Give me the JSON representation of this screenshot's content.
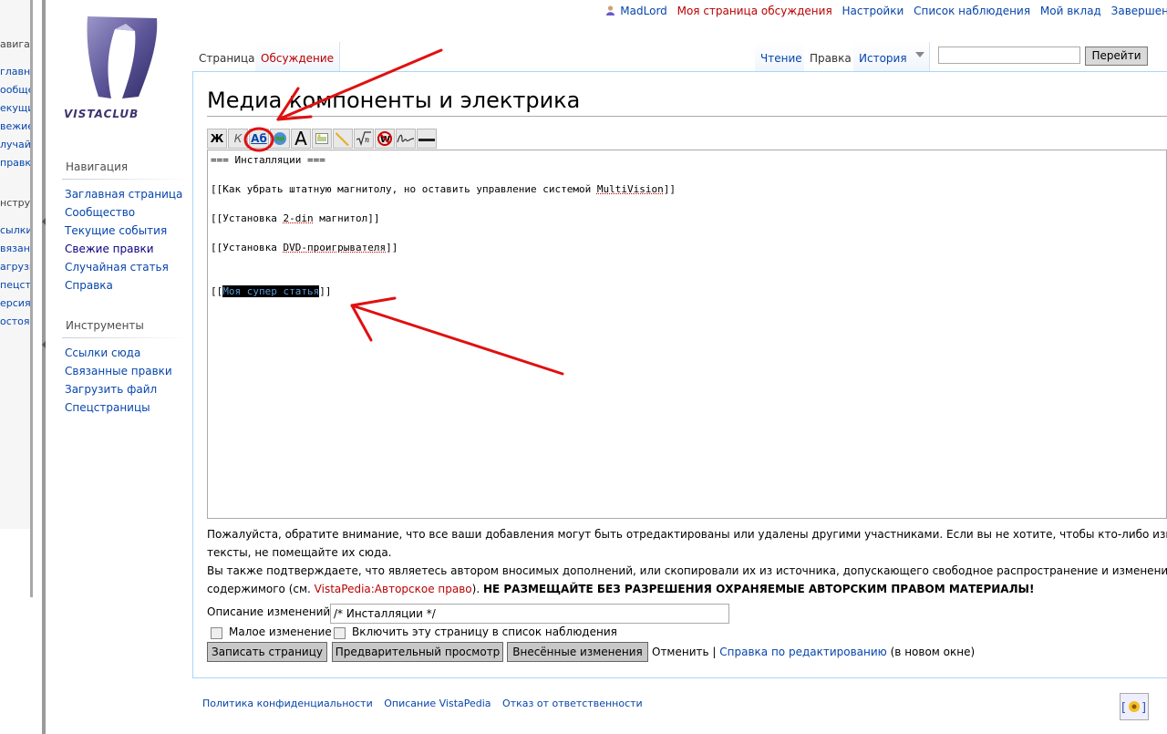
{
  "left_window": {
    "items": [
      "авигац",
      "главн",
      "ообще",
      "екущие",
      "вежие",
      "лучайн",
      "правка",
      "нструм",
      "сылки",
      "вязанн",
      "агрузит",
      "пецстр",
      "ерсия",
      "остоян"
    ]
  },
  "logo": {
    "text": "VISTACLUB"
  },
  "sidebar": {
    "nav_heading": "Навигация",
    "nav_items": [
      "Заглавная страница",
      "Сообщество",
      "Текущие события",
      "Свежие правки",
      "Случайная статья",
      "Справка"
    ],
    "tools_heading": "Инструменты",
    "tools_items": [
      "Ссылки сюда",
      "Связанные правки",
      "Загрузить файл",
      "Спецстраницы"
    ]
  },
  "personal": {
    "user": "MadLord",
    "talk": "Моя страница обсуждения",
    "prefs": "Настройки",
    "watchlist": "Список наблюдения",
    "contribs": "Мой вклад",
    "logout": "Завершен"
  },
  "tabs": {
    "page": "Страница",
    "talk": "Обсуждение",
    "read": "Чтение",
    "edit": "Правка",
    "history": "История"
  },
  "search": {
    "button": "Перейти",
    "value": ""
  },
  "page_title": "Медиа компоненты и электрика",
  "toolbar": {
    "bold": "Ж",
    "italic": "К",
    "link": "Аб",
    "headline": "A"
  },
  "editor": {
    "line1": "=== Инсталляции ===",
    "line2a": "[[Как убрать штатную магнитолу, но оставить управление системой ",
    "line2b": "MultiVision",
    "line2c": "]]",
    "line3a": "[[Установка ",
    "line3b": "2-din",
    "line3c": " магнитол]]",
    "line4a": "[[Установка ",
    "line4b": "DVD-проигрывателя",
    "line4c": "]]",
    "line5a": "[[",
    "line5b": "Моя супер статья",
    "line5c": "]]"
  },
  "notice": {
    "line1": "Пожалуйста, обратите внимание, что все ваши добавления могут быть отредактированы или удалены другими участниками. Если вы не хотите, чтобы кто-либо изменял ва",
    "line2": "тексты, не помещайте их сюда.",
    "line3": "Вы также подтверждаете, что являетесь автором вносимых дополнений, или скопировали их из источника, допускающего свободное распространение и изменение своег",
    "line4a": "содержимого (см. ",
    "line4link": "VistaPedia:Авторское право",
    "line4b": "). ",
    "line4bold": "НЕ РАЗМЕЩАЙТЕ БЕЗ РАЗРЕШЕНИЯ ОХРАНЯЕМЫЕ АВТОРСКИМ ПРАВОМ МАТЕРИАЛЫ!"
  },
  "summary": {
    "label": "Описание изменений:",
    "value": "/* Инсталляции */"
  },
  "options": {
    "minor": "Малое изменение",
    "watch": "Включить эту страницу в список наблюдения"
  },
  "buttons": {
    "save": "Записать страницу",
    "preview": "Предварительный просмотр",
    "diff": "Внесённые изменения",
    "cancel": "Отменить",
    "sep": "|",
    "help": "Справка по редактированию",
    "help_suffix": "(в новом окне)"
  },
  "footer": {
    "privacy": "Политика конфиденциальности",
    "about": "Описание VistaPedia",
    "disclaimer": "Отказ от ответственности"
  },
  "colors": {
    "annotation": "#e01010",
    "link": "#0645ad",
    "redlink": "#ba0000"
  }
}
